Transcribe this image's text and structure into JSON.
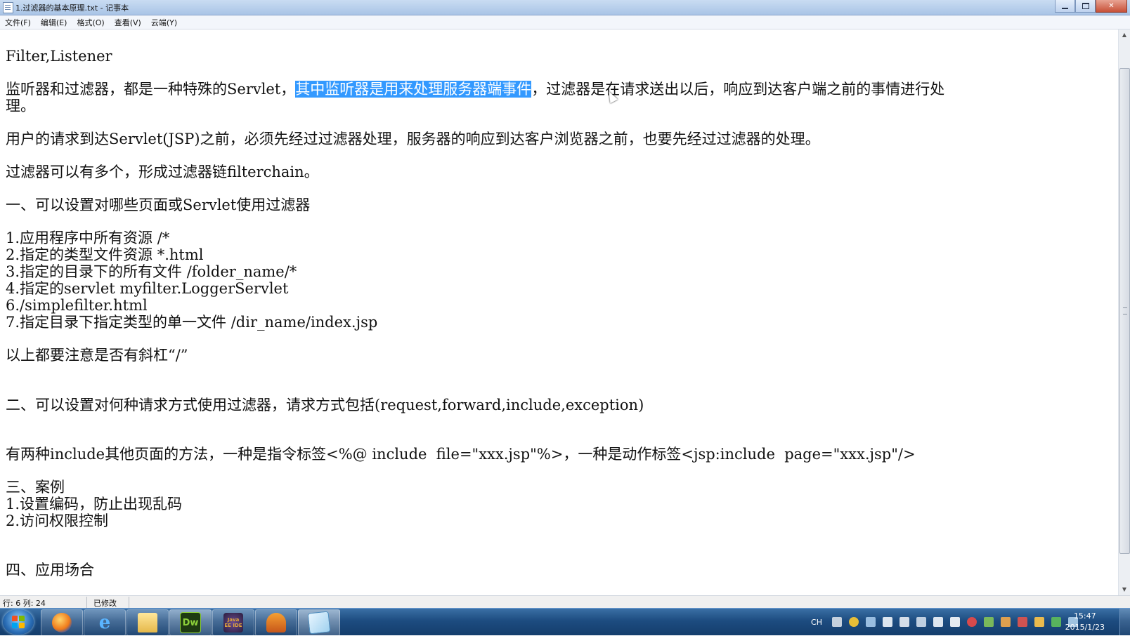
{
  "window": {
    "title": "1.过滤器的基本原理.txt - 记事本",
    "buttons": {
      "minimize": "minimize",
      "maximize": "maximize",
      "close": "✕"
    }
  },
  "menu": {
    "items": [
      "文件(F)",
      "编辑(E)",
      "格式(O)",
      "查看(V)",
      "云端(Y)"
    ]
  },
  "document": {
    "lines": [
      {
        "text": "Filter,Listener"
      },
      {
        "before": "监听器和过滤器，都是一种特殊的Servlet，",
        "selected": "其中监听器是用来处理服务器端事件",
        "after": "，过滤器是在请求送出以后，响应到达客户端之前的事情进行处"
      },
      {
        "text": "理。"
      },
      {
        "text": "用户的请求到达Servlet(JSP)之前，必须先经过过滤器处理，服务器的响应到达客户浏览器之前，也要先经过过滤器的处理。"
      },
      {
        "text": "过滤器可以有多个，形成过滤器链filterchain。"
      },
      {
        "text": "一、可以设置对哪些页面或Servlet使用过滤器"
      },
      {
        "text": "1.应用程序中所有资源 /*"
      },
      {
        "text": "2.指定的类型文件资源 *.html"
      },
      {
        "text": "3.指定的目录下的所有文件 /folder_name/*"
      },
      {
        "text": "4.指定的servlet myfilter.LoggerServlet"
      },
      {
        "text": "6./simplefilter.html"
      },
      {
        "text": "7.指定目录下指定类型的单一文件 /dir_name/index.jsp"
      },
      {
        "text": "以上都要注意是否有斜杠“/”"
      },
      {
        "text": "二、可以设置对何种请求方式使用过滤器，请求方式包括(request,forward,include,exception)"
      },
      {
        "text": "有两种include其他页面的方法，一种是指令标签<%@ include  file=\"xxx.jsp\"%>，一种是动作标签<jsp:include  page=\"xxx.jsp\"/>"
      },
      {
        "text": "三、案例"
      },
      {
        "text": "1.设置编码，防止出现乱码"
      },
      {
        "text": "2.访问权限控制"
      },
      {
        "text": "四、应用场合"
      }
    ]
  },
  "status": {
    "position": "行: 6  列: 24",
    "modified": "已修改"
  },
  "taskbar": {
    "apps": [
      "firefox-icon",
      "ie-icon",
      "explorer-icon",
      "dreamweaver-icon",
      "java-ee-ide-icon",
      "tool-icon",
      "notepad-icon"
    ],
    "dw_label": "Dw",
    "ide_label": "Java EE IDE",
    "lang": "CH",
    "time": "15:47",
    "date": "2015/1/23"
  }
}
